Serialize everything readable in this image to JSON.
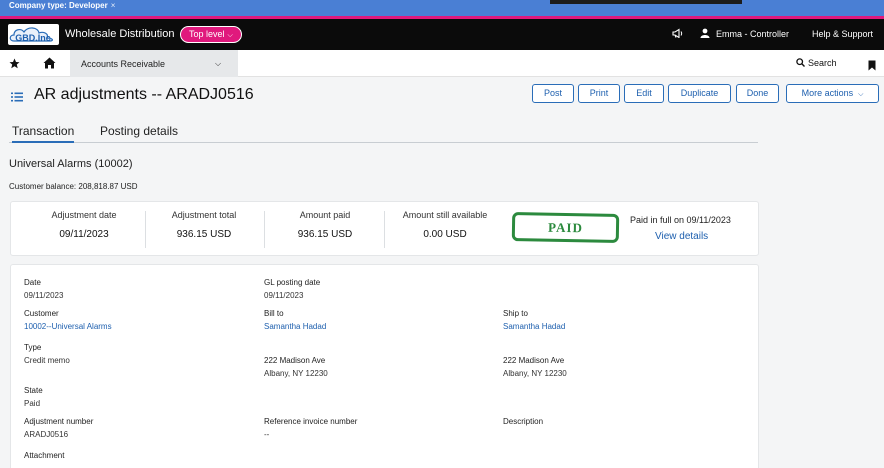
{
  "topbar": {
    "company_type": "Company type: Developer",
    "close": "×"
  },
  "header": {
    "logo_text": "GBD.Inc",
    "company": "Wholesale Distribution",
    "level": "Top level",
    "user": "Emma - Controller",
    "help": "Help & Support"
  },
  "nav": {
    "module": "Accounts Receivable",
    "search": "Search"
  },
  "page": {
    "title": "AR adjustments -- ARADJ0516",
    "buttons": {
      "post": "Post",
      "print": "Print",
      "edit": "Edit",
      "duplicate": "Duplicate",
      "done": "Done",
      "more": "More actions"
    }
  },
  "tabs": {
    "transaction": "Transaction",
    "posting": "Posting details"
  },
  "customer": {
    "name": "Universal Alarms (10002)",
    "balance": "Customer balance: 208,818.87 USD"
  },
  "summary": {
    "adj_date_label": "Adjustment date",
    "adj_date": "09/11/2023",
    "adj_total_label": "Adjustment total",
    "adj_total": "936.15 USD",
    "amount_paid_label": "Amount paid",
    "amount_paid": "936.15 USD",
    "still_label": "Amount still available",
    "still": "0.00 USD",
    "stamp": "PAID",
    "paid_full": "Paid in full on 09/11/2023",
    "view_details": "View details"
  },
  "details": {
    "date_label": "Date",
    "date": "09/11/2023",
    "gl_label": "GL posting date",
    "gl": "09/11/2023",
    "customer_label": "Customer",
    "customer": "10002--Universal Alarms",
    "billto_label": "Bill to",
    "billto": "Samantha Hadad",
    "shipto_label": "Ship to",
    "shipto": "Samantha Hadad",
    "type_label": "Type",
    "type": "Credit memo",
    "bill_addr1": "222 Madison Ave",
    "bill_addr2": "Albany, NY 12230",
    "ship_addr1": "222 Madison Ave",
    "ship_addr2": "Albany, NY 12230",
    "state_label": "State",
    "state": "Paid",
    "adjnum_label": "Adjustment number",
    "adjnum": "ARADJ0516",
    "refinv_label": "Reference invoice number",
    "refinv": "--",
    "desc_label": "Description",
    "attach_label": "Attachment"
  },
  "colors": {
    "accent": "#2a6db8",
    "brand_pink": "#e0197d",
    "paid_green": "#2c8a3e"
  }
}
